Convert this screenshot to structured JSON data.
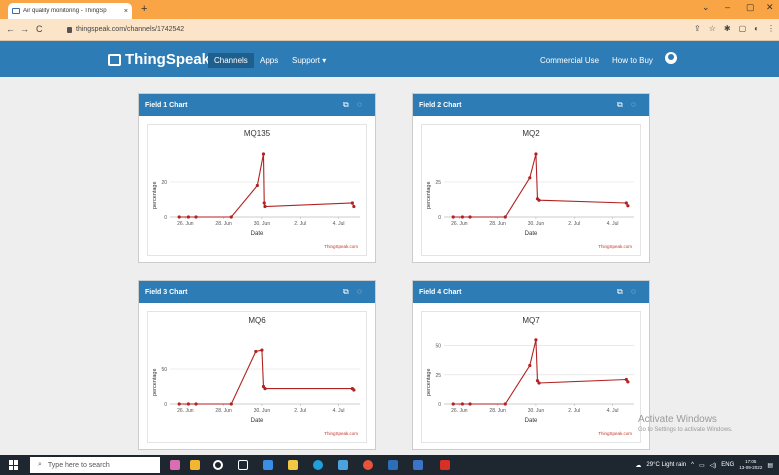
{
  "browser": {
    "tab_title": "Air quality monitoring - ThingSp",
    "tab_close": "×",
    "new_tab": "+",
    "url": "thingspeak.com/channels/1742542",
    "window_controls": [
      "⌄",
      "–",
      "▢",
      "✕"
    ],
    "nav": {
      "back": "←",
      "forward": "→",
      "reload": "C"
    },
    "ext_icons": [
      "⇪",
      "☆",
      "✱",
      "▢",
      "◐",
      "⋮"
    ]
  },
  "thingspeak": {
    "brand": "ThingSpeak",
    "trademark": "™",
    "nav_left": [
      "Channels",
      "Apps",
      "Support ▾"
    ],
    "nav_right": [
      "Commercial Use",
      "How to Buy"
    ]
  },
  "panels": [
    {
      "header": "Field 1 Chart",
      "title": "MQ135",
      "ylabel": "percentage",
      "xlabel": "Date",
      "credit": "ThingSpeak.com"
    },
    {
      "header": "Field 2 Chart",
      "title": "MQ2",
      "ylabel": "percentage",
      "xlabel": "Date",
      "credit": "ThingSpeak.com"
    },
    {
      "header": "Field 3 Chart",
      "title": "MQ6",
      "ylabel": "percentage",
      "xlabel": "Date",
      "credit": "ThingSpeak.com"
    },
    {
      "header": "Field 4 Chart",
      "title": "MQ7",
      "ylabel": "percentage",
      "xlabel": "Date",
      "credit": "ThingSpeak.com"
    }
  ],
  "panel_icons": {
    "external": "⧉",
    "comment": "◌"
  },
  "chart_data": [
    {
      "type": "line",
      "title": "MQ135",
      "xlabel": "Date",
      "ylabel": "percentage",
      "x_tick_labels": [
        "26. Jun",
        "28. Jun",
        "30. Jun",
        "2. Jul",
        "4. Jul"
      ],
      "y_ticks": [
        0,
        20
      ],
      "ylim": [
        0,
        40
      ],
      "color": "#b22222",
      "x": [
        0.6,
        1.2,
        1.7,
        4.0,
        5.7,
        6.1,
        6.15,
        6.2,
        11.9,
        12.0
      ],
      "y": [
        0,
        0,
        0,
        0,
        18,
        36,
        8,
        6,
        8,
        6
      ]
    },
    {
      "type": "line",
      "title": "MQ2",
      "xlabel": "Date",
      "ylabel": "percentage",
      "x_tick_labels": [
        "26. Jun",
        "28. Jun",
        "30. Jun",
        "2. Jul",
        "4. Jul"
      ],
      "y_ticks": [
        0,
        25
      ],
      "ylim": [
        0,
        50
      ],
      "color": "#b22222",
      "x": [
        0.6,
        1.2,
        1.7,
        4.0,
        5.6,
        6.0,
        6.1,
        6.2,
        11.9,
        12.0
      ],
      "y": [
        0,
        0,
        0,
        0,
        28,
        45,
        13,
        12,
        10,
        8
      ]
    },
    {
      "type": "line",
      "title": "MQ6",
      "xlabel": "Date",
      "ylabel": "percentage",
      "x_tick_labels": [
        "26. Jun",
        "28. Jun",
        "30. Jun",
        "2. Jul",
        "4. Jul"
      ],
      "y_ticks": [
        0,
        50
      ],
      "ylim": [
        0,
        100
      ],
      "color": "#b22222",
      "x": [
        0.6,
        1.2,
        1.7,
        4.0,
        5.6,
        6.0,
        6.1,
        6.2,
        11.9,
        12.0
      ],
      "y": [
        0,
        0,
        0,
        0,
        75,
        77,
        25,
        22,
        22,
        20
      ]
    },
    {
      "type": "line",
      "title": "MQ7",
      "xlabel": "Date",
      "ylabel": "percentage",
      "x_tick_labels": [
        "26. Jun",
        "28. Jun",
        "30. Jun",
        "2. Jul",
        "4. Jul"
      ],
      "y_ticks": [
        0,
        25,
        50
      ],
      "ylim": [
        0,
        60
      ],
      "color": "#b22222",
      "x": [
        0.6,
        1.2,
        1.7,
        4.0,
        5.6,
        6.0,
        6.1,
        6.2,
        11.9,
        12.0
      ],
      "y": [
        0,
        0,
        0,
        0,
        33,
        55,
        20,
        18,
        21,
        19
      ]
    }
  ],
  "watermark": {
    "line1": "Activate Windows",
    "line2": "Go to Settings to activate Windows."
  },
  "taskbar": {
    "search_placeholder": "Type here to search",
    "weather": "29°C Light rain",
    "lang": "ENG",
    "time": "17:05",
    "date": "13-09-2022"
  }
}
